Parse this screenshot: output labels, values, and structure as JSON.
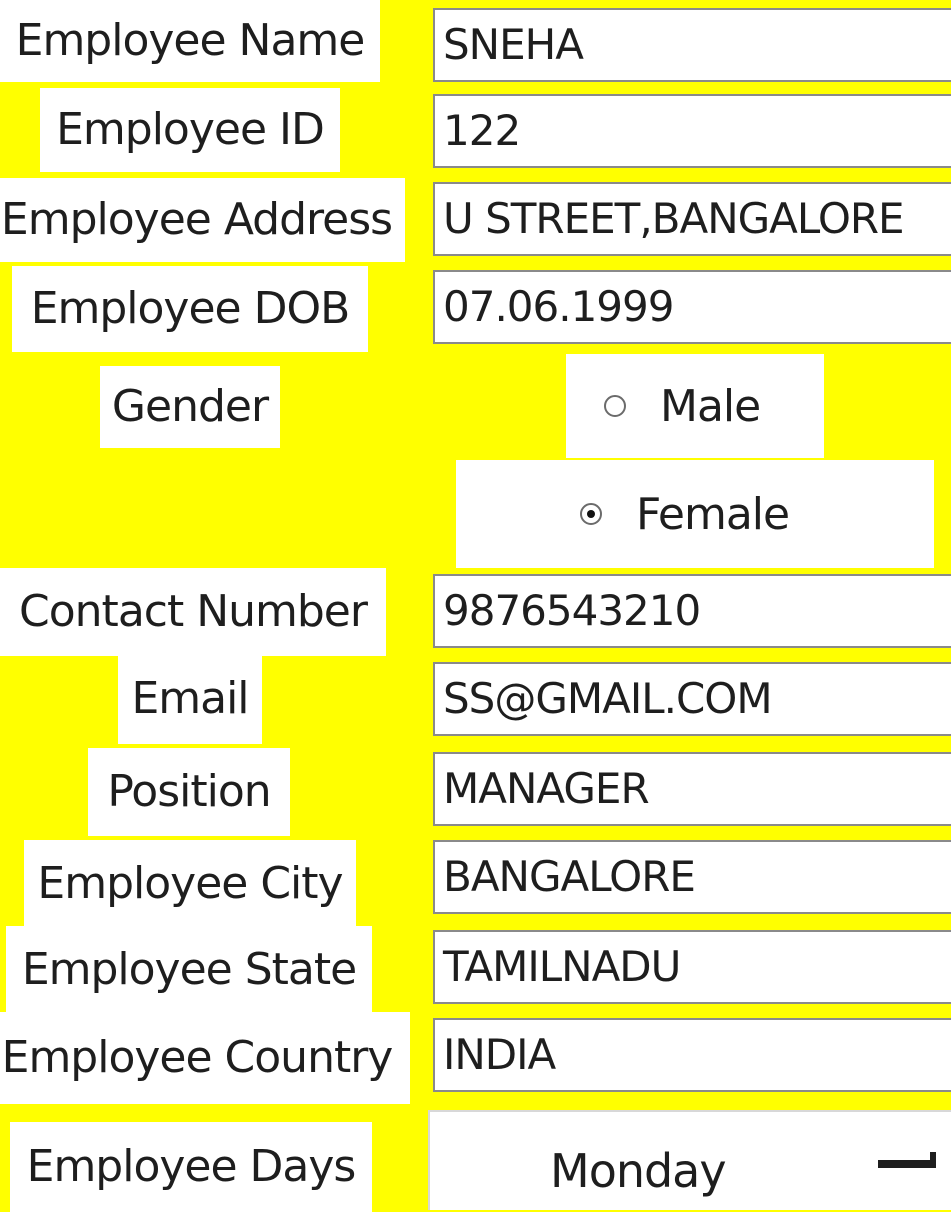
{
  "form": {
    "labels": {
      "name": "Employee Name",
      "id": "Employee ID",
      "address": "Employee Address",
      "dob": "Employee DOB",
      "gender": "Gender",
      "contact": "Contact Number",
      "email": "Email",
      "position": "Position",
      "city": "Employee City",
      "state": "Employee State",
      "country": "Employee Country",
      "days": "Employee Days"
    },
    "values": {
      "name": "SNEHA",
      "id": "122",
      "address": "U STREET,BANGALORE",
      "dob": "07.06.1999",
      "contact": "9876543210",
      "email": "SS@GMAIL.COM",
      "position": "MANAGER",
      "city": "BANGALORE",
      "state": "TAMILNADU",
      "country": "INDIA",
      "days": "Monday"
    },
    "gender_options": {
      "male": "Male",
      "female": "Female",
      "selected": "Female"
    }
  },
  "colors": {
    "background": "#ffff00",
    "field_background": "#ffffff"
  },
  "icons": {
    "dropdown": "dropdown-arrow-icon"
  }
}
